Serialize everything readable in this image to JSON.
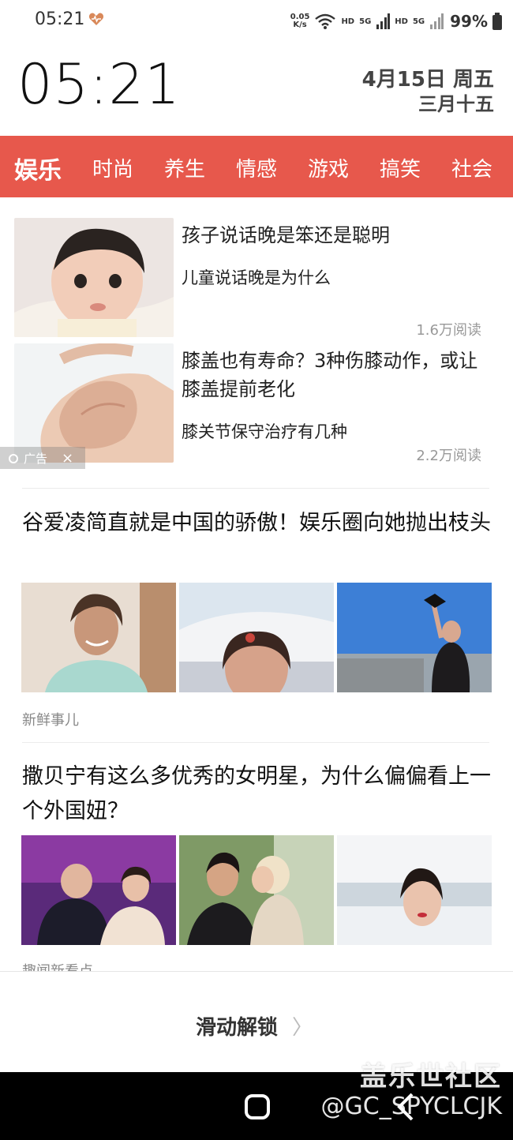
{
  "status_bar": {
    "time": "05:21",
    "net_speed_value": "0.05",
    "net_speed_unit": "K/s",
    "hd1": "HD",
    "sig1": "5G",
    "hd2": "HD",
    "sig2": "5G",
    "battery": "99%",
    "icons": [
      "heart-icon",
      "wifi-icon",
      "signal-icon",
      "battery-icon"
    ]
  },
  "lock": {
    "clock": "05:21",
    "date": "4月15日  周五",
    "lunar_date": "三月十五"
  },
  "tabs": [
    {
      "label": "娱乐",
      "active": true
    },
    {
      "label": "时尚"
    },
    {
      "label": "养生"
    },
    {
      "label": "情感"
    },
    {
      "label": "游戏"
    },
    {
      "label": "搞笑"
    },
    {
      "label": "社会"
    }
  ],
  "ad_articles": [
    {
      "title": "孩子说话晚是笨还是聪明",
      "subtitle": "儿童说话晚是为什么",
      "reads": "1.6万阅读"
    },
    {
      "title": "膝盖也有寿命？3种伤膝动作，或让膝盖提前老化",
      "subtitle": "膝关节保守治疗有几种",
      "reads": "2.2万阅读"
    }
  ],
  "ad_badge": {
    "label": "广告",
    "close": "×"
  },
  "articles": [
    {
      "title": "谷爱凌简直就是中国的骄傲！娱乐圈向她抛出枝头",
      "source": "新鲜事儿"
    },
    {
      "title": "撒贝宁有这么多优秀的女明星，为什么偏偏看上一个外国妞？",
      "source": "趣闻新看点"
    }
  ],
  "unlock": {
    "label": "滑动解锁",
    "chevron": "〉"
  },
  "watermark": {
    "line1": "盖乐世社区",
    "line2": "@GC_SPYCLCJK"
  },
  "colors": {
    "tab_bg": "#e7584c",
    "accent_heart": "#d9895a"
  }
}
